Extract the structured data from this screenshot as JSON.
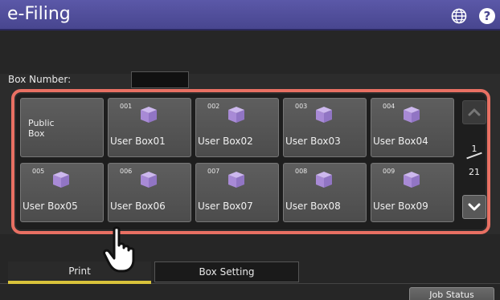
{
  "app": {
    "title": "e-Filing"
  },
  "header": {
    "globe_icon": "globe-icon",
    "help_icon": "help-icon",
    "help_glyph": "?"
  },
  "box_number": {
    "label": "Box Number:",
    "value": ""
  },
  "boxes": {
    "public": {
      "line1": "Public",
      "line2": "Box"
    },
    "items": [
      {
        "number": "001",
        "name": "User Box01"
      },
      {
        "number": "002",
        "name": "User Box02"
      },
      {
        "number": "003",
        "name": "User Box03"
      },
      {
        "number": "004",
        "name": "User Box04"
      },
      {
        "number": "005",
        "name": "User Box05"
      },
      {
        "number": "006",
        "name": "User Box06"
      },
      {
        "number": "007",
        "name": "User Box07"
      },
      {
        "number": "008",
        "name": "User Box08"
      },
      {
        "number": "009",
        "name": "User Box09"
      }
    ]
  },
  "pager": {
    "current": "1",
    "total": "21"
  },
  "tabs": {
    "print": "Print",
    "box_setting": "Box Setting"
  },
  "footer": {
    "job_status": "Job Status"
  },
  "colors": {
    "title_bar": "#48468f",
    "highlight": "#e87063",
    "active_tab": "#d9c33b",
    "cube": "#b79ce0"
  }
}
